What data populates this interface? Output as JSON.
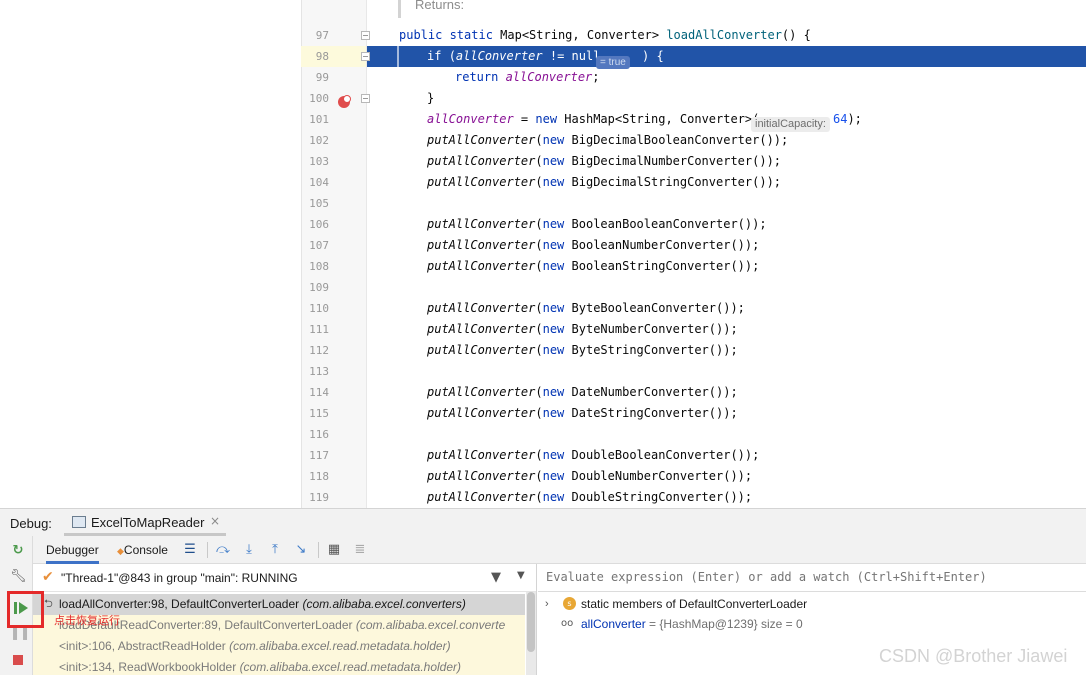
{
  "editor": {
    "doc_returns": "Returns:",
    "lines": [
      {
        "num": "97",
        "text": "public static Map<String, Converter> loadAllConverter() {"
      },
      {
        "num": "98",
        "text": "if (allConverter != null",
        "hint": "= true",
        "suffix": ") {"
      },
      {
        "num": "99",
        "text": "return allConverter;"
      },
      {
        "num": "100",
        "text": "}"
      },
      {
        "num": "101",
        "text_a": "allConverter = new HashMap<String, Converter>(",
        "param_hint": "initialCapacity:",
        "text_b": " 64);"
      },
      {
        "num": "102",
        "text": "putAllConverter(new BigDecimalBooleanConverter());"
      },
      {
        "num": "103",
        "text": "putAllConverter(new BigDecimalNumberConverter());"
      },
      {
        "num": "104",
        "text": "putAllConverter(new BigDecimalStringConverter());"
      },
      {
        "num": "105",
        "text": ""
      },
      {
        "num": "106",
        "text": "putAllConverter(new BooleanBooleanConverter());"
      },
      {
        "num": "107",
        "text": "putAllConverter(new BooleanNumberConverter());"
      },
      {
        "num": "108",
        "text": "putAllConverter(new BooleanStringConverter());"
      },
      {
        "num": "109",
        "text": ""
      },
      {
        "num": "110",
        "text": "putAllConverter(new ByteBooleanConverter());"
      },
      {
        "num": "111",
        "text": "putAllConverter(new ByteNumberConverter());"
      },
      {
        "num": "112",
        "text": "putAllConverter(new ByteStringConverter());"
      },
      {
        "num": "113",
        "text": ""
      },
      {
        "num": "114",
        "text": "putAllConverter(new DateNumberConverter());"
      },
      {
        "num": "115",
        "text": "putAllConverter(new DateStringConverter());"
      },
      {
        "num": "116",
        "text": ""
      },
      {
        "num": "117",
        "text": "putAllConverter(new DoubleBooleanConverter());"
      },
      {
        "num": "118",
        "text": "putAllConverter(new DoubleNumberConverter());"
      },
      {
        "num": "119",
        "text": "putAllConverter(new DoubleStringConverter());"
      }
    ]
  },
  "debug": {
    "label": "Debug:",
    "session_name": "ExcelToMapReader",
    "session_close": "×",
    "tabs": {
      "debugger": "Debugger",
      "console": "Console"
    },
    "thread": "\"Thread-1\"@843 in group \"main\": RUNNING",
    "frames": [
      {
        "method": "loadAllConverter:98, DefaultConverterLoader ",
        "pkg": "(com.alibaba.excel.converters)"
      },
      {
        "method": "loadDefaultReadConverter:89, DefaultConverterLoader ",
        "pkg": "(com.alibaba.excel.converte"
      },
      {
        "method": "<init>:106, AbstractReadHolder ",
        "pkg": "(com.alibaba.excel.read.metadata.holder)"
      },
      {
        "method": "<init>:134, ReadWorkbookHolder ",
        "pkg": "(com.alibaba.excel.read.metadata.holder)"
      }
    ],
    "eval_placeholder": "Evaluate expression (Enter) or add a watch (Ctrl+Shift+Enter)",
    "variables": [
      {
        "icon": "s",
        "name": "static",
        "rest": " members of DefaultConverterLoader"
      },
      {
        "icon": "oo",
        "name": "allConverter",
        "rest": " = {HashMap@1239}  size = 0"
      }
    ]
  },
  "annotation": "点击恢复运行",
  "watermark": "CSDN @Brother Jiawei",
  "colors": {
    "execution_line": "#2154a8",
    "breakpoint": "#e04c4c",
    "annotation_red": "#e42a2a",
    "resume_green": "#4c9a4c"
  },
  "icons": [
    "breakpoint-icon",
    "fold-icon",
    "rerun-icon",
    "wrench-icon",
    "resume-icon",
    "pause-icon",
    "stop-icon",
    "check-icon",
    "filter-icon",
    "step-over-icon",
    "step-into-icon",
    "step-out-icon",
    "run-to-cursor-icon",
    "table-icon",
    "static-members-icon",
    "watch-icon"
  ]
}
